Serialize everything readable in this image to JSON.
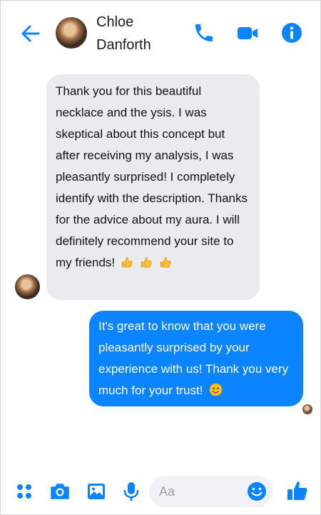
{
  "header": {
    "contact_name": "Chloe Danforth",
    "icons": [
      "back-arrow-icon",
      "phone-icon",
      "video-camera-icon",
      "info-icon"
    ]
  },
  "messages": [
    {
      "direction": "incoming",
      "text": "Thank you for this beautiful necklace and the ysis. I was skeptical about this concept but after receiving my analysis, I was pleasantly surprised! I completely identify with the description. Thanks for the advice about my aura. I will definitely recommend your site to my friends!",
      "emojis": [
        "thumbs-up",
        "thumbs-up",
        "thumbs-up"
      ]
    },
    {
      "direction": "outgoing",
      "text": "It's great to know that you were pleasantly surprised by your experience with us! Thank you very much for your trust!",
      "emojis": [
        "smiling-face"
      ]
    }
  ],
  "composer": {
    "placeholder": "Aa",
    "icons": [
      "more-options-icon",
      "camera-icon",
      "gallery-icon",
      "microphone-icon",
      "emoji-icon",
      "like-icon"
    ]
  },
  "colors": {
    "accent": "#0a84ff",
    "incoming_bubble": "#e9ebef",
    "outgoing_bubble": "#0a84ff"
  }
}
